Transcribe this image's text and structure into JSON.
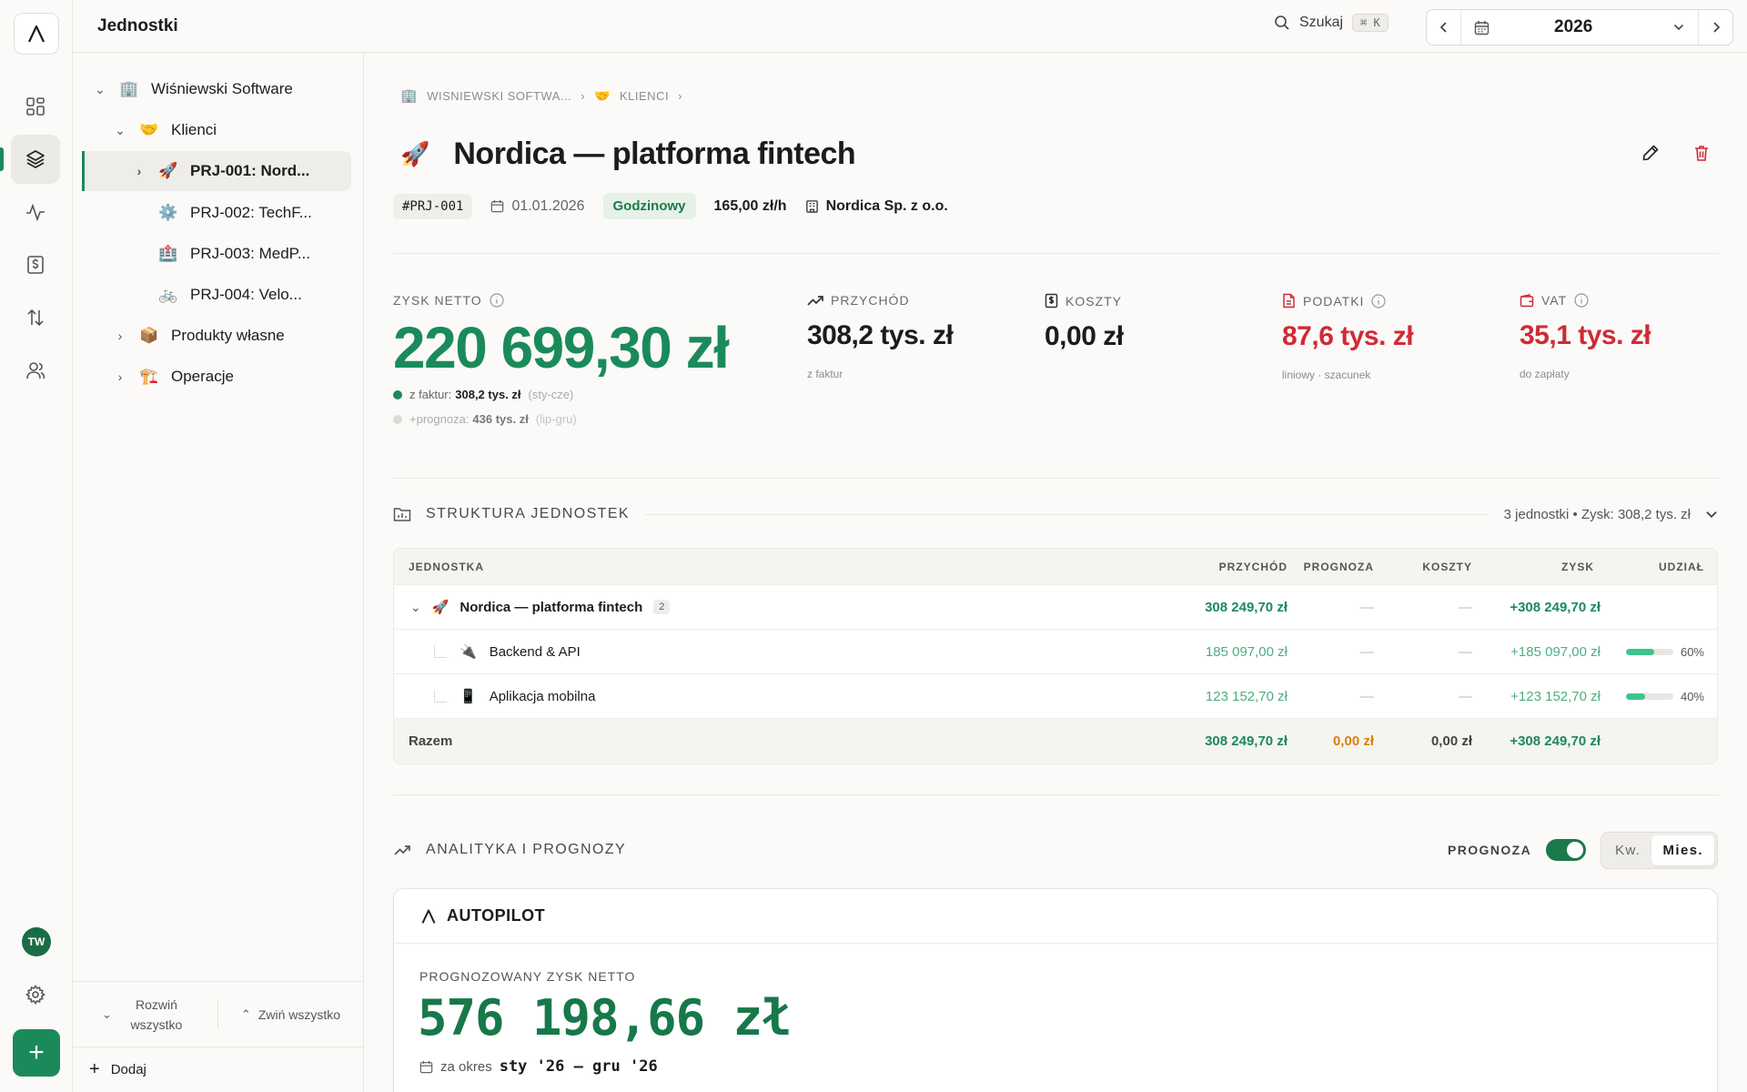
{
  "app": {
    "logo_letter": "A",
    "user_initials": "TW"
  },
  "topbar": {
    "title": "Jednostki",
    "search_label": "Szukaj",
    "search_shortcut": "⌘ K",
    "year": "2026"
  },
  "tree": {
    "nodes": [
      {
        "label": "Wiśniewski Software",
        "icon": "🏢",
        "icon_name": "office-building-icon"
      },
      {
        "label": "Klienci",
        "icon": "🤝",
        "icon_name": "handshake-icon"
      },
      {
        "label": "PRJ-001: Nord...",
        "icon": "🚀",
        "icon_name": "rocket-icon"
      },
      {
        "label": "PRJ-002: TechF...",
        "icon": "⚙️",
        "icon_name": "gear-icon"
      },
      {
        "label": "PRJ-003: MedP...",
        "icon": "🏥",
        "icon_name": "hospital-icon"
      },
      {
        "label": "PRJ-004: Velo...",
        "icon": "🚲",
        "icon_name": "bicycle-icon"
      },
      {
        "label": "Produkty własne",
        "icon": "📦",
        "icon_name": "package-icon"
      },
      {
        "label": "Operacje",
        "icon": "🏗️",
        "icon_name": "construction-icon"
      }
    ],
    "expand_all": "Rozwiń wszystko",
    "collapse_all": "Zwiń wszystko",
    "add": "Dodaj"
  },
  "breadcrumb": {
    "level1": "WISNIEWSKI SOFTWA...",
    "level2": "KLIENCI"
  },
  "project": {
    "icon": "🚀",
    "title": "Nordica — platforma fintech",
    "id": "#PRJ-001",
    "date": "01.01.2026",
    "billing_type": "Godzinowy",
    "rate": "165,00 zł/h",
    "client": "Nordica Sp. z o.o."
  },
  "kpis": {
    "net_profit": {
      "label": "ZYSK NETTO",
      "value": "220 699,30 zł",
      "line1_prefix": "z faktur:",
      "line1_value": "308,2 tys. zł",
      "line1_period": "(sty-cze)",
      "line2_prefix": "+prognoza:",
      "line2_value": "436 tys. zł",
      "line2_period": "(lip-gru)"
    },
    "revenue": {
      "label": "PRZYCHÓD",
      "value": "308,2 tys. zł",
      "sub": "z faktur"
    },
    "costs": {
      "label": "KOSZTY",
      "value": "0,00 zł",
      "sub": ""
    },
    "taxes": {
      "label": "PODATKI",
      "value": "87,6 tys. zł",
      "sub": "liniowy · szacunek"
    },
    "vat": {
      "label": "VAT",
      "value": "35,1 tys. zł",
      "sub": "do zapłaty"
    }
  },
  "structure": {
    "title": "STRUKTURA JEDNOSTEK",
    "summary": "3 jednostki • Zysk: 308,2 tys. zł",
    "columns": {
      "unit": "JEDNOSTKA",
      "revenue": "PRZYCHÓD",
      "forecast": "PROGNOZA",
      "costs": "KOSZTY",
      "profit": "ZYSK",
      "share": "UDZIAŁ"
    },
    "parent": {
      "icon": "🚀",
      "name": "Nordica — platforma fintech",
      "count": "2",
      "revenue": "308 249,70 zł",
      "forecast": "—",
      "costs": "—",
      "profit": "+308 249,70 zł"
    },
    "children": [
      {
        "icon": "🔌",
        "name": "Backend & API",
        "revenue": "185 097,00 zł",
        "forecast": "—",
        "costs": "—",
        "profit": "+185 097,00 zł",
        "share": "60%",
        "share_value": 0.6
      },
      {
        "icon": "📱",
        "name": "Aplikacja mobilna",
        "revenue": "123 152,70 zł",
        "forecast": "—",
        "costs": "—",
        "profit": "+123 152,70 zł",
        "share": "40%",
        "share_value": 0.4
      }
    ],
    "total": {
      "label": "Razem",
      "revenue": "308 249,70 zł",
      "forecast": "0,00 zł",
      "costs": "0,00 zł",
      "profit": "+308 249,70 zł"
    }
  },
  "analytics": {
    "title": "ANALITYKA I PROGNOZY",
    "forecast_toggle_label": "PROGNOZA",
    "forecast_on": true,
    "period_options": [
      "Kw.",
      "Mies."
    ],
    "period_selected": "Mies."
  },
  "autopilot": {
    "title": "AUTOPILOT",
    "metric_label": "PROGNOZOWANY ZYSK NETTO",
    "value": "576 198,66 zł",
    "period_prefix": "za okres",
    "period": "sty '26 – gru '26"
  },
  "colors": {
    "accent": "#1b8a5a",
    "danger": "#d02a35",
    "warning": "#d9820b"
  }
}
